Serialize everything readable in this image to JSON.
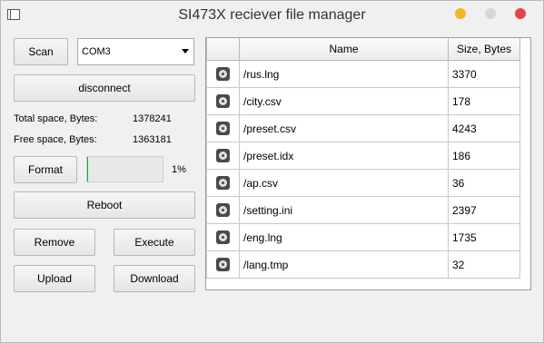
{
  "window": {
    "title": "SI473X reciever file manager"
  },
  "controls": {
    "scan_label": "Scan",
    "port_value": "COM3",
    "disconnect_label": "disconnect",
    "total_space_label": "Total space, Bytes:",
    "total_space_value": "1378241",
    "free_space_label": "Free space, Bytes:",
    "free_space_value": "1363181",
    "format_label": "Format",
    "progress_percent": 1,
    "progress_text": "1%",
    "reboot_label": "Reboot",
    "remove_label": "Remove",
    "execute_label": "Execute",
    "upload_label": "Upload",
    "download_label": "Download"
  },
  "files": {
    "columns": [
      "Name",
      "Size, Bytes"
    ],
    "rows": [
      {
        "name": "/rus.lng",
        "size": "3370",
        "icon": "file-icon"
      },
      {
        "name": "/city.csv",
        "size": "178",
        "icon": "file-icon"
      },
      {
        "name": "/preset.csv",
        "size": "4243",
        "icon": "file-icon"
      },
      {
        "name": "/preset.idx",
        "size": "186",
        "icon": "file-icon"
      },
      {
        "name": "/ap.csv",
        "size": "36",
        "icon": "file-icon"
      },
      {
        "name": "/setting.ini",
        "size": "2397",
        "icon": "file-icon"
      },
      {
        "name": "/eng.lng",
        "size": "1735",
        "icon": "file-icon"
      },
      {
        "name": "/lang.tmp",
        "size": "32",
        "icon": "file-icon"
      }
    ]
  }
}
